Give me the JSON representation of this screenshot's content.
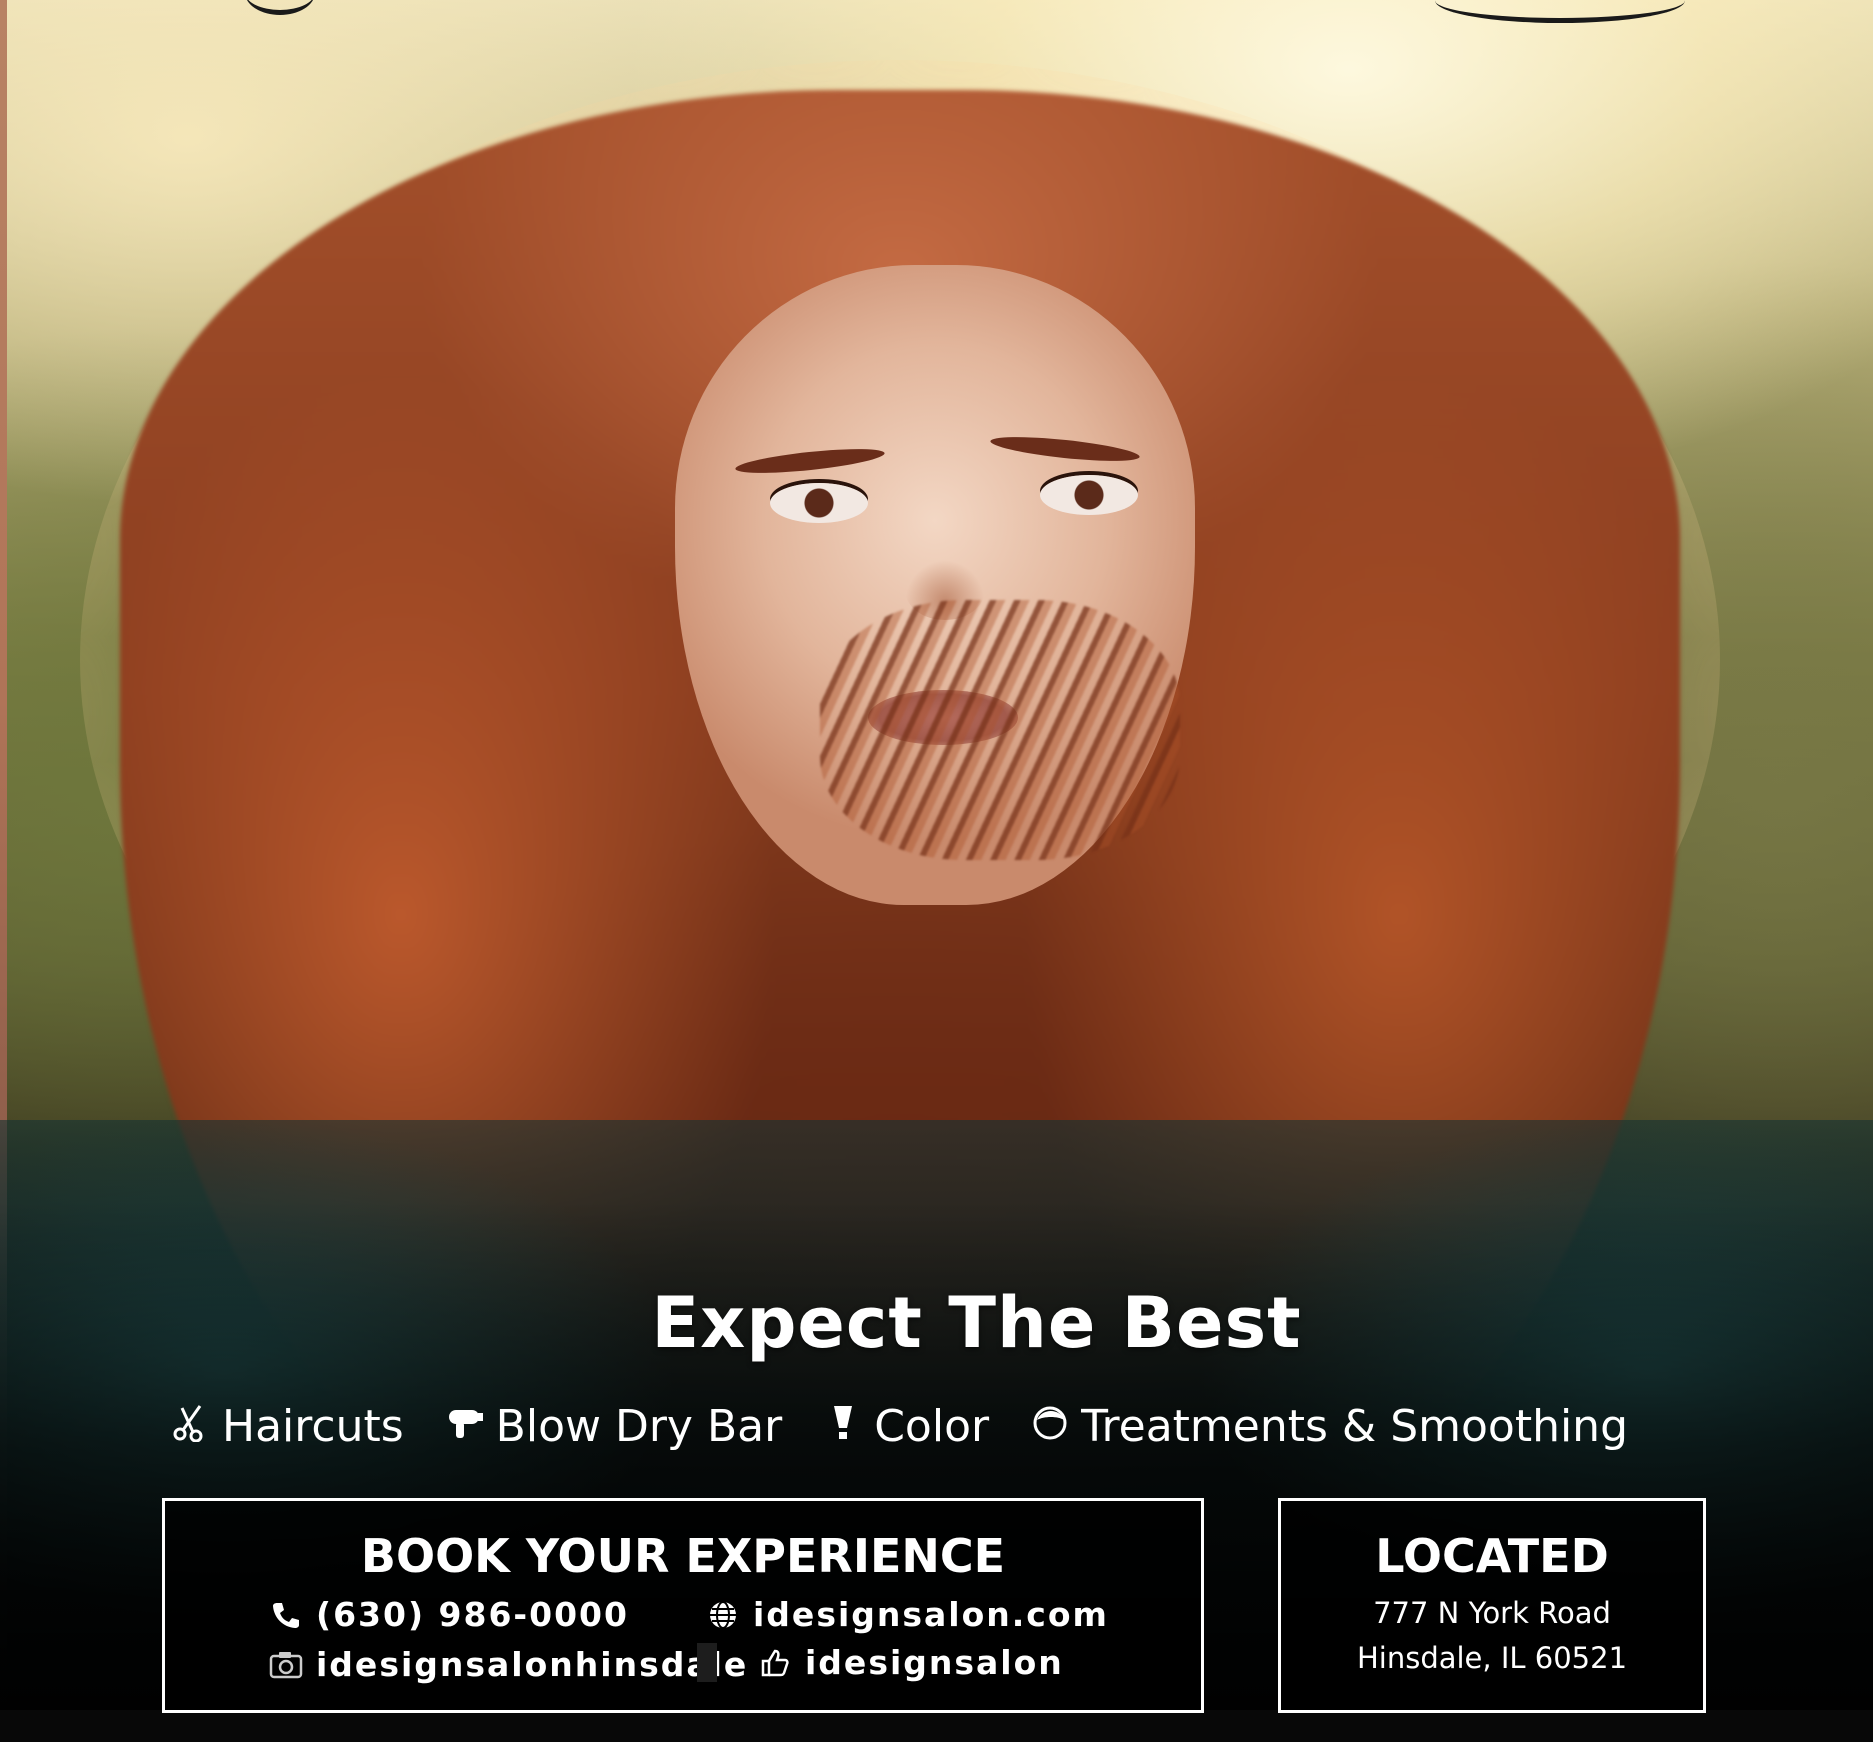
{
  "headline": "Expect The Best",
  "services": [
    {
      "icon": "scissors-icon",
      "label": "Haircuts"
    },
    {
      "icon": "hair-dryer-icon",
      "label": "Blow Dry Bar"
    },
    {
      "icon": "color-tube-icon",
      "label": "Color"
    },
    {
      "icon": "treatment-icon",
      "label": "Treatments & Smoothing"
    }
  ],
  "book": {
    "title": "BOOK YOUR EXPERIENCE",
    "phone": "(630) 986-0000",
    "website": "idesignsalon.com",
    "instagram": "idesignsalonhinsdale",
    "facebook": "idesignsalon"
  },
  "location": {
    "title": "LOCATED",
    "line1": "777 N York Road",
    "line2": "Hinsdale, IL 60521"
  },
  "colors": {
    "text": "#ffffff",
    "box_border": "#ffffff",
    "box_fill": "#000000",
    "hair": "#8a3d1f"
  }
}
